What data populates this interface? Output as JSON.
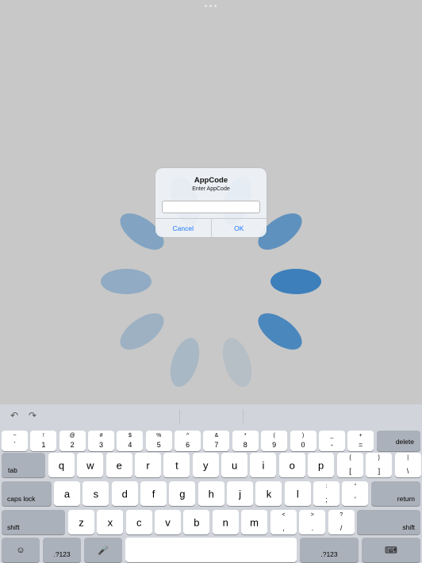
{
  "alert": {
    "title": "AppCode",
    "message": "Enter AppCode",
    "input_value": "",
    "cancel_label": "Cancel",
    "ok_label": "OK"
  },
  "spinner": {
    "accent_color": "#3c7fbb",
    "petal_count": 10
  },
  "toolbar": {
    "undo_icon": "undo-icon",
    "redo_icon": "redo-icon"
  },
  "keyboard": {
    "row1": [
      {
        "top": "~",
        "bottom": "`"
      },
      {
        "top": "!",
        "bottom": "1"
      },
      {
        "top": "@",
        "bottom": "2"
      },
      {
        "top": "#",
        "bottom": "3"
      },
      {
        "top": "$",
        "bottom": "4"
      },
      {
        "top": "%",
        "bottom": "5"
      },
      {
        "top": "^",
        "bottom": "6"
      },
      {
        "top": "&",
        "bottom": "7"
      },
      {
        "top": "*",
        "bottom": "8"
      },
      {
        "top": "(",
        "bottom": "9"
      },
      {
        "top": ")",
        "bottom": "0"
      },
      {
        "top": "_",
        "bottom": "-"
      },
      {
        "top": "+",
        "bottom": "="
      }
    ],
    "delete_label": "delete",
    "tab_label": "tab",
    "row2": [
      "q",
      "w",
      "e",
      "r",
      "t",
      "y",
      "u",
      "i",
      "o",
      "p"
    ],
    "row2_symbols": [
      {
        "top": "{",
        "bottom": "["
      },
      {
        "top": "}",
        "bottom": "]"
      },
      {
        "top": "|",
        "bottom": "\\"
      }
    ],
    "caps_label": "caps lock",
    "row3": [
      "a",
      "s",
      "d",
      "f",
      "g",
      "h",
      "j",
      "k",
      "l"
    ],
    "row3_symbols": [
      {
        "top": ":",
        "bottom": ";"
      },
      {
        "top": "\"",
        "bottom": "'"
      }
    ],
    "return_label": "return",
    "shift_label": "shift",
    "row4": [
      "z",
      "x",
      "c",
      "v",
      "b",
      "n",
      "m"
    ],
    "row4_symbols": [
      {
        "top": "<",
        "bottom": ","
      },
      {
        "top": ">",
        "bottom": "."
      },
      {
        "top": "?",
        "bottom": "/"
      }
    ],
    "numbers_label": ".?123",
    "emoji_icon": "emoji-icon",
    "mic_icon": "microphone-icon",
    "dismiss_icon": "keyboard-dismiss-icon"
  }
}
